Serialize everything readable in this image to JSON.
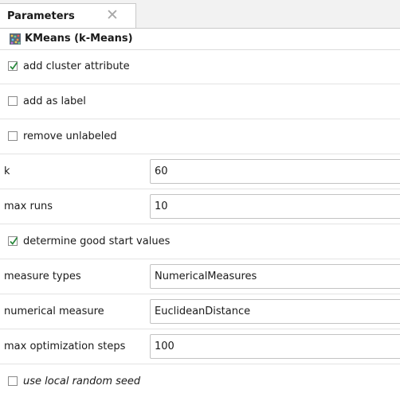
{
  "tab": {
    "title": "Parameters",
    "close_glyph": "✕"
  },
  "operator": {
    "icon": "kmeans-operator-icon",
    "title": "KMeans (k-Means)"
  },
  "params": {
    "add_cluster_attribute": {
      "label": "add cluster attribute",
      "checked": true
    },
    "add_as_label": {
      "label": "add as label",
      "checked": false
    },
    "remove_unlabeled": {
      "label": "remove unlabeled",
      "checked": false
    },
    "k": {
      "label": "k",
      "value": "60"
    },
    "max_runs": {
      "label": "max runs",
      "value": "10"
    },
    "determine_good_start_values": {
      "label": "determine good start values",
      "checked": true
    },
    "measure_types": {
      "label": "measure types",
      "value": "NumericalMeasures"
    },
    "numerical_measure": {
      "label": "numerical measure",
      "value": "EuclideanDistance"
    },
    "max_optimization_steps": {
      "label": "max optimization steps",
      "value": "100"
    },
    "use_local_random_seed": {
      "label": "use local random seed",
      "checked": false
    }
  },
  "colors": {
    "check": "#2b8a3e",
    "checkbox_border": "#8a8a8a"
  }
}
